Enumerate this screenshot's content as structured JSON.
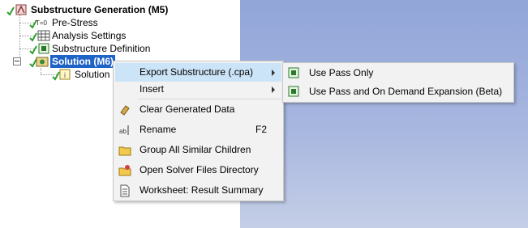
{
  "tree": {
    "root_label": "Substructure Generation (M5)",
    "items": [
      {
        "label": "Pre-Stress",
        "icon": "pre-stress-icon"
      },
      {
        "label": "Analysis Settings",
        "icon": "analysis-settings-icon"
      },
      {
        "label": "Substructure Definition",
        "icon": "substructure-definition-icon"
      },
      {
        "label": "Solution (M6)",
        "icon": "solution-icon",
        "selected": true
      },
      {
        "label": "Solution In",
        "icon": "solution-information-icon"
      }
    ],
    "pre_stress_icon_text": "T=0"
  },
  "context_menu": {
    "items": [
      {
        "label": "Export Substructure (.cpa)",
        "has_submenu": true,
        "highlighted": true
      },
      {
        "label": "Insert",
        "has_submenu": true
      },
      {
        "label": "Clear Generated Data",
        "icon": "eraser-icon"
      },
      {
        "label": "Rename",
        "icon": "rename-icon",
        "shortcut": "F2"
      },
      {
        "label": "Group All Similar Children",
        "icon": "folder-icon"
      },
      {
        "label": "Open Solver Files Directory",
        "icon": "open-folder-icon"
      },
      {
        "label": "Worksheet: Result Summary",
        "icon": "worksheet-icon"
      }
    ]
  },
  "submenu": {
    "items": [
      {
        "label": "Use Pass Only",
        "icon": "pass-icon"
      },
      {
        "label": "Use Pass and On Demand Expansion (Beta)",
        "icon": "pass-expansion-icon"
      }
    ]
  },
  "colors": {
    "selection": "#1e63c7",
    "menu_highlight": "#cce4f7",
    "check_green": "#2e9e2e",
    "viewport_top": "#91a5d8"
  }
}
